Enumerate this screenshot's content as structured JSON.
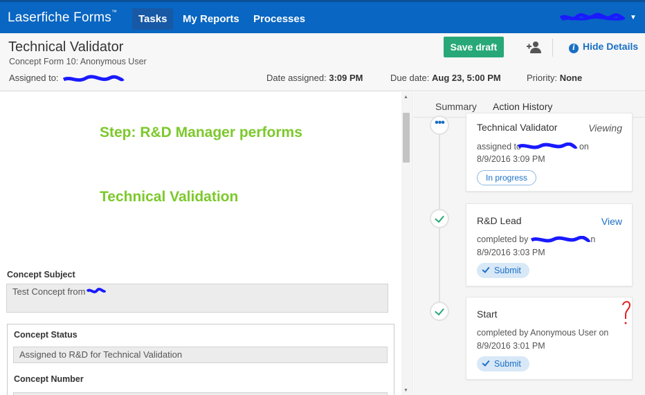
{
  "nav": {
    "brand": "Laserfiche Forms",
    "brand_mark": "™",
    "items": [
      {
        "label": "Tasks",
        "active": true
      },
      {
        "label": "My Reports",
        "active": false
      },
      {
        "label": "Processes",
        "active": false
      }
    ]
  },
  "header": {
    "title": "Technical Validator",
    "subtitle": "Concept Form 10: Anonymous User",
    "assigned_label": "Assigned to:",
    "date_assigned_label": "Date assigned:",
    "date_assigned_value": "3:09 PM",
    "due_label": "Due date:",
    "due_value": "Aug 23, 5:00 PM",
    "priority_label": "Priority:",
    "priority_value": "None",
    "save_draft": "Save draft",
    "hide_details": "Hide Details"
  },
  "form": {
    "step_line1": "Step: R&D Manager performs",
    "step_line2": "Technical Validation",
    "concept_subject_label": "Concept Subject",
    "concept_subject_value": "Test Concept from",
    "concept_status_label": "Concept Status",
    "concept_status_value": "Assigned to R&D for Technical Validation",
    "concept_number_label": "Concept Number"
  },
  "details": {
    "tabs": [
      {
        "label": "Summary",
        "active": false
      },
      {
        "label": "Action History",
        "active": true
      }
    ],
    "history": [
      {
        "title": "Technical Validator",
        "status": "Viewing",
        "line1": "assigned to",
        "line1_tail": "on",
        "line2": "8/9/2016 3:09 PM",
        "badge": "In progress",
        "state": "in-progress"
      },
      {
        "title": "R&D Lead",
        "status": "View",
        "line1": "completed by",
        "line1_tail": "n",
        "line2": "8/9/2016 3:03 PM",
        "badge": "Submit",
        "state": "done"
      },
      {
        "title": "Start",
        "status": "",
        "line1": "completed by Anonymous User on",
        "line1_tail": "",
        "line2": "8/9/2016 3:01 PM",
        "badge": "Submit",
        "state": "done"
      }
    ]
  },
  "colors": {
    "nav_bg": "#0966c2",
    "accent_green": "#28a878",
    "link_blue": "#1a6fc4",
    "step_text_green": "#7cc92b"
  }
}
